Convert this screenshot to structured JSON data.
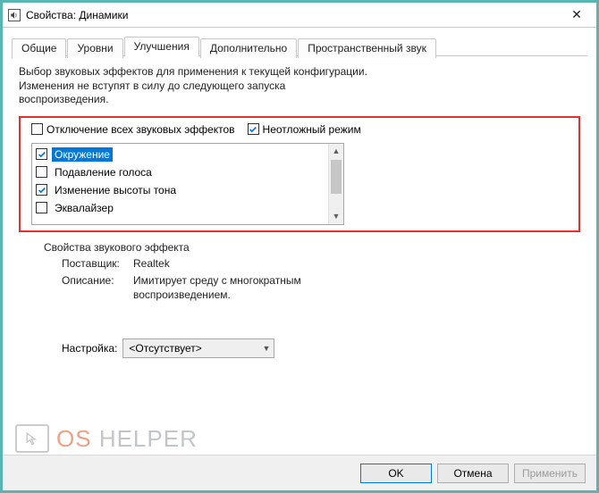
{
  "window": {
    "title": "Свойства: Динамики"
  },
  "tabs": [
    {
      "label": "Общие"
    },
    {
      "label": "Уровни"
    },
    {
      "label": "Улучшения"
    },
    {
      "label": "Дополнительно"
    },
    {
      "label": "Пространственный звук"
    }
  ],
  "active_tab_index": 2,
  "enh": {
    "intro": "Выбор звуковых эффектов для применения к текущей конфигурации. Изменения не вступят в силу до следующего запуска воспроизведения.",
    "disable_all": {
      "label": "Отключение всех звуковых эффектов",
      "checked": false
    },
    "urgent_mode": {
      "label": "Неотложный режим",
      "checked": true
    },
    "effects": [
      {
        "label": "Окружение",
        "checked": true,
        "selected": true
      },
      {
        "label": "Подавление голоса",
        "checked": false,
        "selected": false
      },
      {
        "label": "Изменение высоты тона",
        "checked": true,
        "selected": false
      },
      {
        "label": "Эквалайзер",
        "checked": false,
        "selected": false
      }
    ],
    "section_title": "Свойства звукового эффекта",
    "provider_label": "Поставщик:",
    "provider_value": "Realtek",
    "desc_label": "Описание:",
    "desc_value": "Имитирует среду с многократным воспроизведением.",
    "setting_label": "Настройка:",
    "setting_value": "<Отсутствует>"
  },
  "footer": {
    "ok": "OK",
    "cancel": "Отмена",
    "apply": "Применить"
  },
  "watermark": {
    "os": "OS",
    "helper": "HELPER"
  }
}
